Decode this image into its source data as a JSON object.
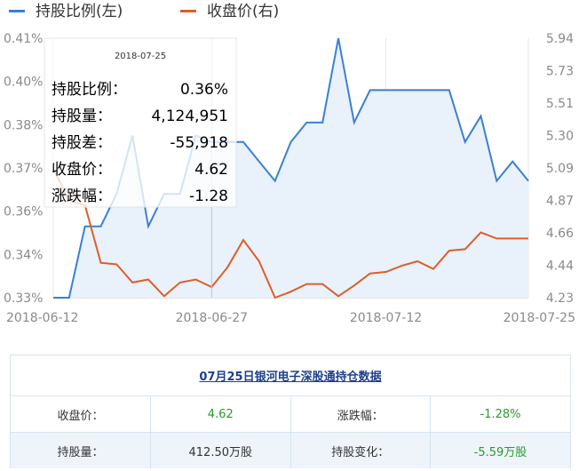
{
  "chart_data": {
    "type": "line",
    "legend": [
      {
        "name": "持股比例(左)",
        "color": "#3a7fd5"
      },
      {
        "name": "收盘价(右)",
        "color": "#dc5e28"
      }
    ],
    "x_ticks": [
      "2018-06-12",
      "2018-06-27",
      "2018-07-12",
      "2018-07-25"
    ],
    "x": [
      "2018-06-12",
      "2018-06-13",
      "2018-06-14",
      "2018-06-15",
      "2018-06-19",
      "2018-06-20",
      "2018-06-21",
      "2018-06-22",
      "2018-06-25",
      "2018-06-26",
      "2018-06-27",
      "2018-06-28",
      "2018-06-29",
      "2018-07-02",
      "2018-07-03",
      "2018-07-04",
      "2018-07-05",
      "2018-07-06",
      "2018-07-09",
      "2018-07-10",
      "2018-07-11",
      "2018-07-12",
      "2018-07-13",
      "2018-07-16",
      "2018-07-17",
      "2018-07-18",
      "2018-07-19",
      "2018-07-20",
      "2018-07-23",
      "2018-07-24",
      "2018-07-25"
    ],
    "left_ticks": [
      "0.41%",
      "0.40%",
      "0.38%",
      "0.37%",
      "0.36%",
      "0.34%",
      "0.33%"
    ],
    "right_ticks": [
      "5.94",
      "5.73",
      "5.51",
      "5.30",
      "5.09",
      "4.87",
      "4.66",
      "4.44",
      "4.23"
    ],
    "left_ylim": [
      0.33,
      0.41
    ],
    "right_ylim": [
      4.23,
      5.94
    ],
    "series": [
      {
        "name": "持股比例(左)",
        "axis": "left",
        "color": "#3a7fd5",
        "values": [
          0.33,
          0.33,
          0.352,
          0.352,
          0.362,
          0.38,
          0.352,
          0.362,
          0.362,
          0.38,
          0.378,
          0.378,
          0.378,
          0.372,
          0.366,
          0.378,
          0.384,
          0.384,
          0.41,
          0.384,
          0.394,
          0.394,
          0.394,
          0.394,
          0.394,
          0.394,
          0.378,
          0.386,
          0.366,
          0.372,
          0.366
        ]
      },
      {
        "name": "收盘价(右)",
        "axis": "right",
        "color": "#dc5e28",
        "values": [
          5.08,
          4.87,
          4.84,
          4.46,
          4.45,
          4.33,
          4.35,
          4.24,
          4.33,
          4.35,
          4.3,
          4.43,
          4.61,
          4.47,
          4.23,
          4.27,
          4.32,
          4.32,
          4.24,
          4.31,
          4.39,
          4.4,
          4.44,
          4.47,
          4.42,
          4.54,
          4.55,
          4.66,
          4.62,
          4.62,
          4.62
        ]
      }
    ],
    "highlight_index": 10,
    "tooltip": {
      "date": "2018-07-25",
      "rows": [
        {
          "label": "持股比例：",
          "value": "0.36%",
          "color": "#000000"
        },
        {
          "label": "持股量：",
          "value": "4,124,951",
          "color": "#000000"
        },
        {
          "label": "持股差：",
          "value": "-55,918",
          "color": "#1a8a1a"
        },
        {
          "label": "收盘价：",
          "value": "4.62",
          "color": "#e02020"
        },
        {
          "label": "涨跌幅：",
          "value": "-1.28",
          "color": "#1a8a1a"
        }
      ]
    }
  },
  "panel": {
    "title": "07月25日银河电子深股通持仓数据",
    "close_label": "收盘价：",
    "close_value": "4.62",
    "change_label": "涨跌幅：",
    "change_value": "-1.28%",
    "holding_label": "持股量：",
    "holding_value": "412.50万股",
    "holding_change_label": "持股变化：",
    "holding_change_value": "-5.59万股"
  }
}
